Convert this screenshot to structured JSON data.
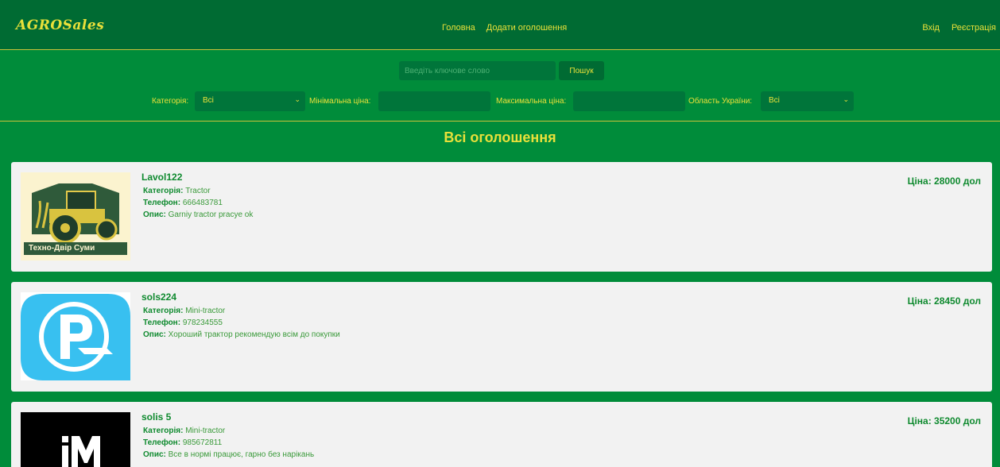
{
  "header": {
    "logo": "AGROSales",
    "nav_center": [
      "Головна",
      "Додати оголошення"
    ],
    "nav_right": [
      "Вхід",
      "Реєстрація"
    ]
  },
  "search": {
    "placeholder": "Введіть ключове слово",
    "value": "",
    "button": "Пошук"
  },
  "filters": {
    "category_label": "Категорія:",
    "category_value": "Всі",
    "min_price_label": "Мінімальна ціна:",
    "min_price_value": "",
    "max_price_label": "Максимальна ціна:",
    "max_price_value": "",
    "region_label": "Область України:",
    "region_value": "Всі"
  },
  "main": {
    "title": "Всі оголошення"
  },
  "listing_labels": {
    "category": "Категорія:",
    "phone": "Телефон:",
    "description": "Опис:"
  },
  "listings": [
    {
      "user": "Lavol122",
      "category": "Tractor",
      "phone": "666483781",
      "description": "Garniy tractor pracye ok",
      "price": "Ціна: 28000 дол",
      "image_text": "Техно-Двір Суми",
      "image": "tractor-logo"
    },
    {
      "user": "sols224",
      "category": "Mini-tractor",
      "phone": "978234555",
      "description": "Хороший трактор рекомендую всім до покупки",
      "price": "Ціна: 28450 дол",
      "image": "r-logo"
    },
    {
      "user": "solis 5",
      "category": "Mini-tractor",
      "phone": "985672811",
      "description": "Все в нормі працює, гарно без нарікань",
      "price": "Ціна: 35200 дол",
      "image": "m-logo"
    }
  ],
  "colors": {
    "header_bg": "#006b33",
    "page_bg": "#008c3a",
    "accent_text": "#e8e03a",
    "card_bg": "#f2f2f2",
    "card_text": "#0f8a2f"
  }
}
